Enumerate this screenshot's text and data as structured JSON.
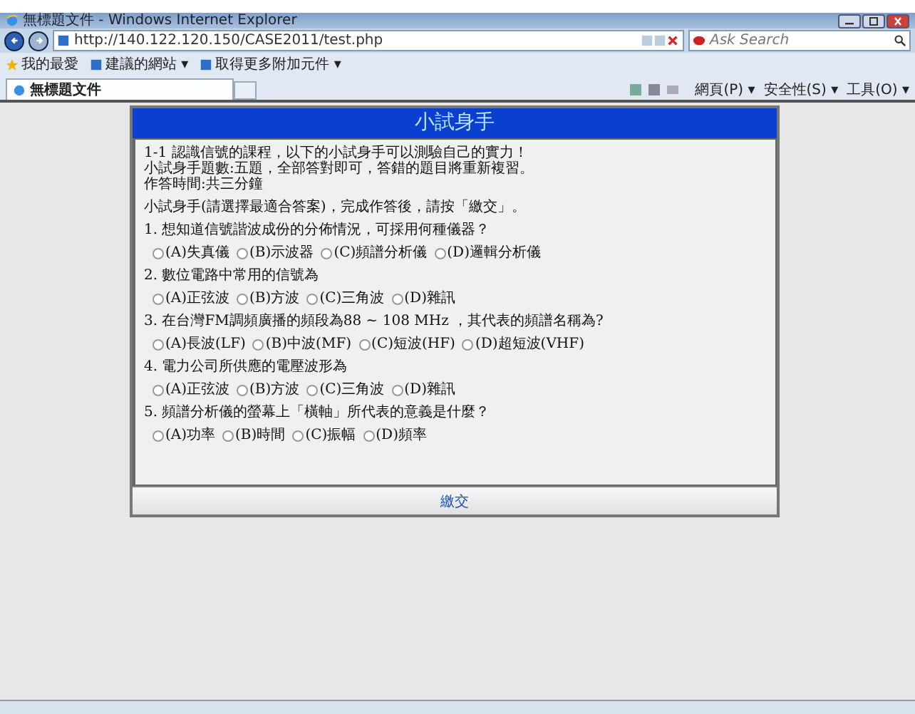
{
  "window": {
    "title": "無標題文件 - Windows Internet Explorer"
  },
  "address_bar": {
    "url": "http://140.122.120.150/CASE2011/test.php"
  },
  "search": {
    "placeholder": "Ask Search"
  },
  "favorites_bar": [
    {
      "label": "我的最愛",
      "kind": "star"
    },
    {
      "label": "建議的網站 ▾",
      "kind": "page"
    },
    {
      "label": "取得更多附加元件 ▾",
      "kind": "page"
    }
  ],
  "tabs": [
    {
      "label": "無標題文件",
      "selected": true
    }
  ],
  "command_bar": [
    "網頁(P) ▾",
    "安全性(S) ▾",
    "工具(O) ▾"
  ],
  "quiz": {
    "title": "小試身手",
    "intro": [
      "1-1 認識信號的課程，以下的小試身手可以測驗自己的實力！",
      "小試身手題數:五題，全部答對即可，答錯的題目將重新複習。",
      "作答時間:共三分鐘"
    ],
    "instruction": "小試身手(請選擇最適合答案)，完成作答後，請按「繳交」。",
    "questions": [
      {
        "text": "1. 想知道信號諧波成份的分佈情況，可採用何種儀器？",
        "options": [
          {
            "label": "(A)失真儀",
            "selected": false
          },
          {
            "label": "(B)示波器",
            "selected": false
          },
          {
            "label": "(C)頻譜分析儀",
            "selected": false
          },
          {
            "label": "(D)邏輯分析儀",
            "selected": false
          }
        ]
      },
      {
        "text": "2. 數位電路中常用的信號為",
        "options": [
          {
            "label": "(A)正弦波",
            "selected": false
          },
          {
            "label": "(B)方波",
            "selected": false
          },
          {
            "label": "(C)三角波",
            "selected": false
          },
          {
            "label": "(D)雜訊",
            "selected": false
          }
        ]
      },
      {
        "text": "3. 在台灣FM調頻廣播的頻段為88 ~ 108 MHz ，其代表的頻譜名稱為?",
        "options": [
          {
            "label": "(A)長波(LF)",
            "selected": false
          },
          {
            "label": "(B)中波(MF)",
            "selected": false
          },
          {
            "label": "(C)短波(HF)",
            "selected": false
          },
          {
            "label": "(D)超短波(VHF)",
            "selected": false
          }
        ]
      },
      {
        "text": "4. 電力公司所供應的電壓波形為",
        "options": [
          {
            "label": "(A)正弦波",
            "selected": false
          },
          {
            "label": "(B)方波",
            "selected": false
          },
          {
            "label": "(C)三角波",
            "selected": false
          },
          {
            "label": "(D)雜訊",
            "selected": false
          }
        ]
      },
      {
        "text": "5. 頻譜分析儀的螢幕上「橫軸」所代表的意義是什麼？",
        "options": [
          {
            "label": "(A)功率",
            "selected": false
          },
          {
            "label": "(B)時間",
            "selected": false
          },
          {
            "label": "(C)振幅",
            "selected": false
          },
          {
            "label": "(D)頻率",
            "selected": false
          }
        ]
      }
    ],
    "submit": "繳交"
  }
}
